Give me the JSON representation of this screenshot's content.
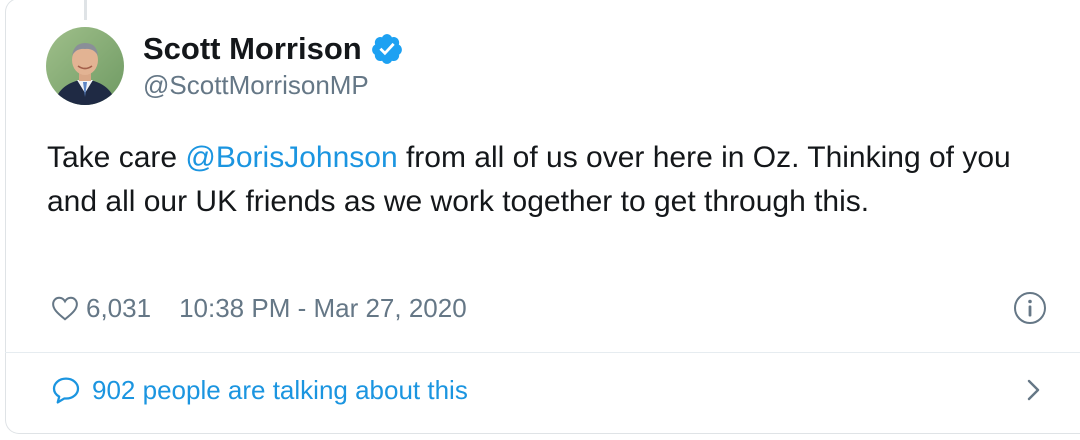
{
  "tweet": {
    "author_name": "Scott Morrison",
    "handle": "@ScottMorrisonMP",
    "text_before": "Take care ",
    "mention": "@BorisJohnson",
    "text_after": " from all of us over here in Oz. Thinking of you and all our UK friends as we work together to get through this.",
    "likes": "6,031",
    "timestamp": "10:38 PM - Mar 27, 2020",
    "talking": "902 people are talking about this"
  },
  "icons": {
    "verified": "verified-badge-icon",
    "like": "heart-icon",
    "info": "info-icon",
    "reply": "speech-bubble-icon",
    "more": "chevron-right-icon"
  },
  "colors": {
    "link": "#1b95e0",
    "text": "#14171a",
    "muted": "#657786",
    "verified": "#1da1f2"
  }
}
